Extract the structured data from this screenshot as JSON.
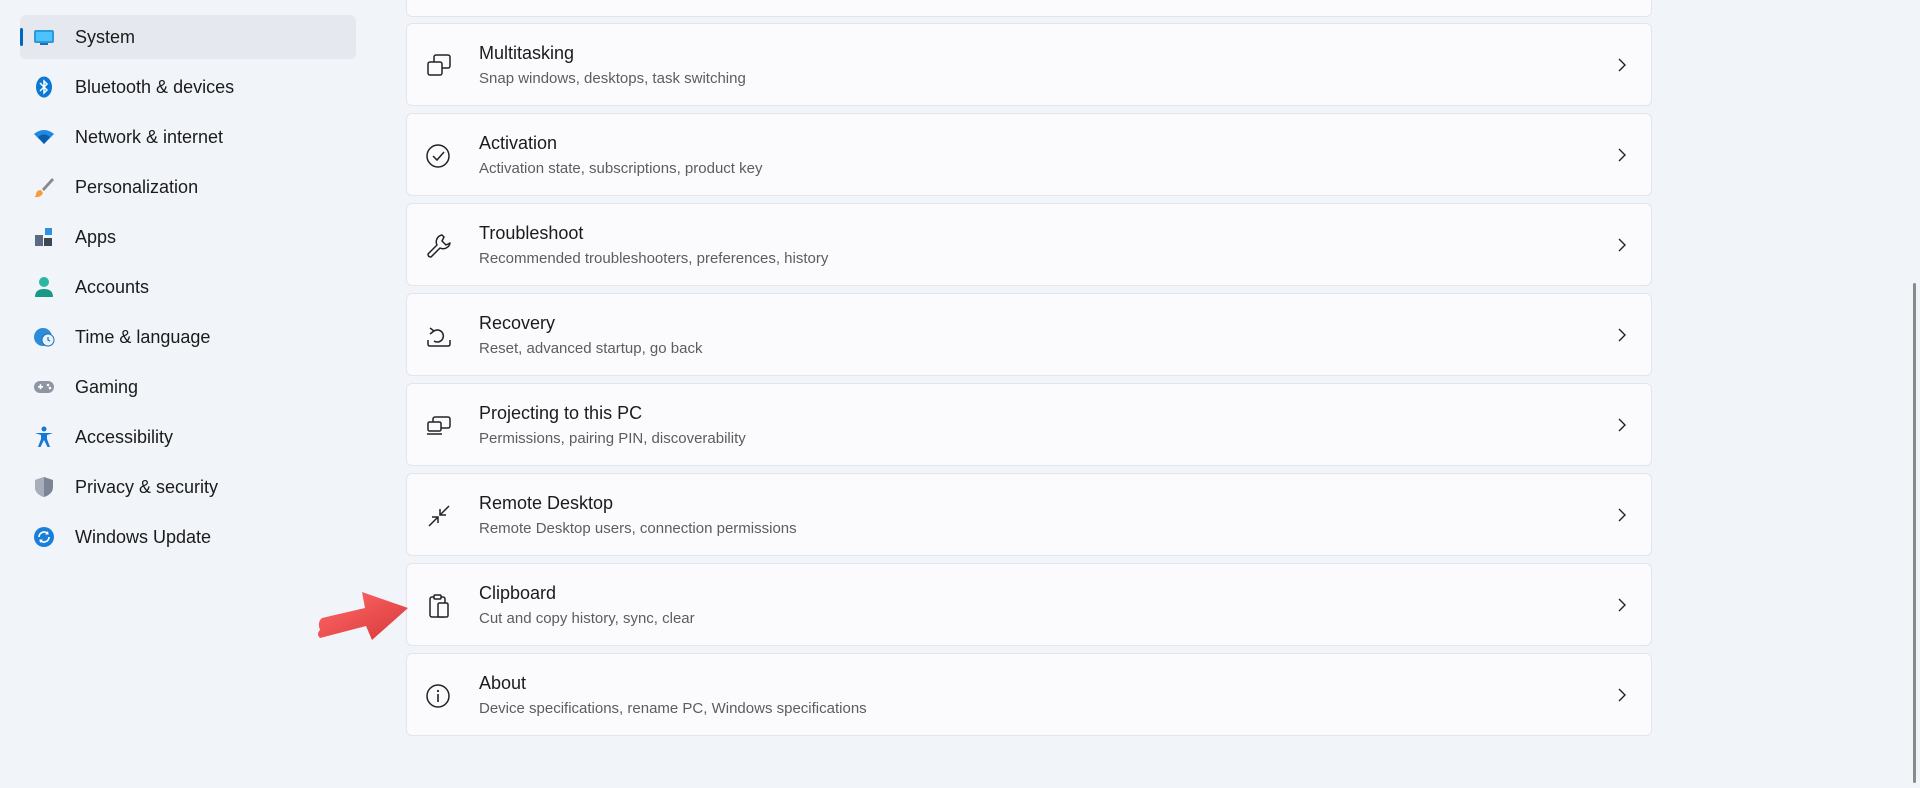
{
  "sidebar": {
    "items": [
      {
        "label": "System",
        "icon": "system-icon",
        "selected": true
      },
      {
        "label": "Bluetooth & devices",
        "icon": "bluetooth-icon"
      },
      {
        "label": "Network & internet",
        "icon": "wifi-icon"
      },
      {
        "label": "Personalization",
        "icon": "brush-icon"
      },
      {
        "label": "Apps",
        "icon": "apps-icon"
      },
      {
        "label": "Accounts",
        "icon": "person-icon"
      },
      {
        "label": "Time & language",
        "icon": "globe-clock-icon"
      },
      {
        "label": "Gaming",
        "icon": "gamepad-icon"
      },
      {
        "label": "Accessibility",
        "icon": "accessibility-icon"
      },
      {
        "label": "Privacy & security",
        "icon": "shield-icon"
      },
      {
        "label": "Windows Update",
        "icon": "update-icon"
      }
    ]
  },
  "main": {
    "cards": [
      {
        "title": "Multitasking",
        "description": "Snap windows, desktops, task switching",
        "icon": "multitasking-icon"
      },
      {
        "title": "Activation",
        "description": "Activation state, subscriptions, product key",
        "icon": "check-circle-icon"
      },
      {
        "title": "Troubleshoot",
        "description": "Recommended troubleshooters, preferences, history",
        "icon": "wrench-icon"
      },
      {
        "title": "Recovery",
        "description": "Reset, advanced startup, go back",
        "icon": "recovery-icon"
      },
      {
        "title": "Projecting to this PC",
        "description": "Permissions, pairing PIN, discoverability",
        "icon": "projecting-icon"
      },
      {
        "title": "Remote Desktop",
        "description": "Remote Desktop users, connection permissions",
        "icon": "remote-desktop-icon"
      },
      {
        "title": "Clipboard",
        "description": "Cut and copy history, sync, clear",
        "icon": "clipboard-icon"
      },
      {
        "title": "About",
        "description": "Device specifications, rename PC, Windows specifications",
        "icon": "info-icon"
      }
    ]
  },
  "colors": {
    "accent": "#0067c0",
    "annotation_arrow": "#ef4b4b",
    "background": "#f1f4f9",
    "card": "#fbfbfd"
  }
}
